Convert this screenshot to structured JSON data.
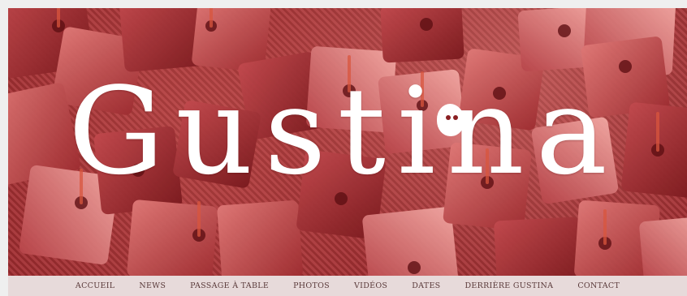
{
  "site": {
    "logo_text": "Gustina",
    "colors": {
      "background": "#efefef",
      "banner": "#8a1f22",
      "logo": "#ffffff",
      "nav_bar": "#eee8e8",
      "nav_text": "#5a3a3a"
    }
  },
  "nav": {
    "items": [
      {
        "label": "Accueil"
      },
      {
        "label": "News"
      },
      {
        "label": "Passage à table"
      },
      {
        "label": "Photos"
      },
      {
        "label": "Vidéos"
      },
      {
        "label": "Dates"
      },
      {
        "label": "Derrière Gustina"
      },
      {
        "label": "Contact"
      }
    ]
  }
}
